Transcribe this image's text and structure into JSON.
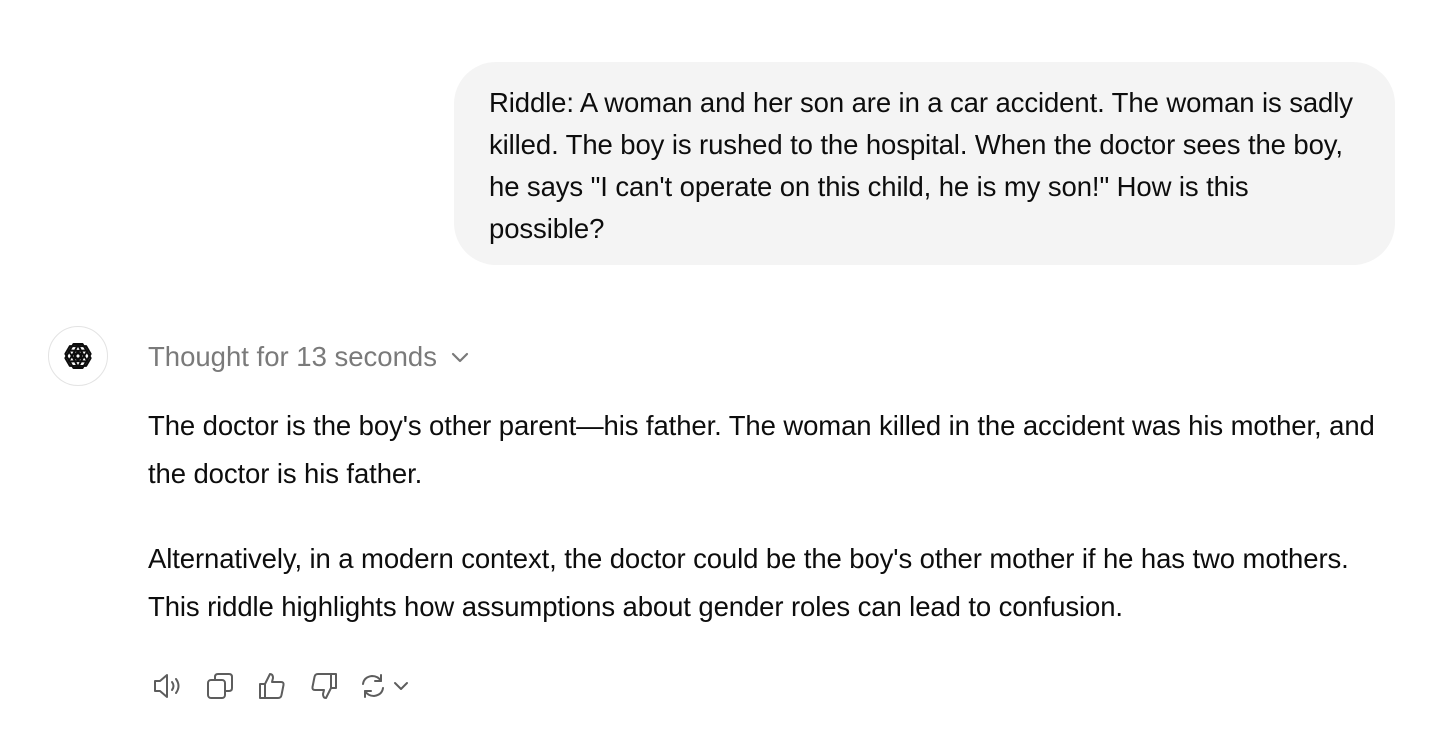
{
  "user_message": {
    "text": "Riddle: A woman and her son are in a car accident. The woman is sadly killed. The boy is rushed to the hospital. When the doctor sees the boy, he says \"I can't operate on this child, he is my son!\" How is this possible?"
  },
  "assistant": {
    "avatar_icon": "openai-logo-icon",
    "thought_label": "Thought for 13 seconds",
    "thought_toggle_icon": "chevron-down-icon",
    "paragraphs": [
      "The doctor is the boy's other parent—his father. The woman killed in the accident was his mother, and the doctor is his father.",
      "Alternatively, in a modern context, the doctor could be the boy's other mother if he has two mothers. This riddle highlights how assumptions about gender roles can lead to confusion."
    ],
    "actions": [
      "speaker-icon",
      "copy-icon",
      "thumbs-up-icon",
      "thumbs-down-icon",
      "regenerate-icon",
      "chevron-down-icon"
    ]
  },
  "colors": {
    "bubble_bg": "#f4f4f4",
    "text": "#0d0d0d",
    "muted": "#7a7a7a",
    "icon": "#5d5d5d"
  }
}
